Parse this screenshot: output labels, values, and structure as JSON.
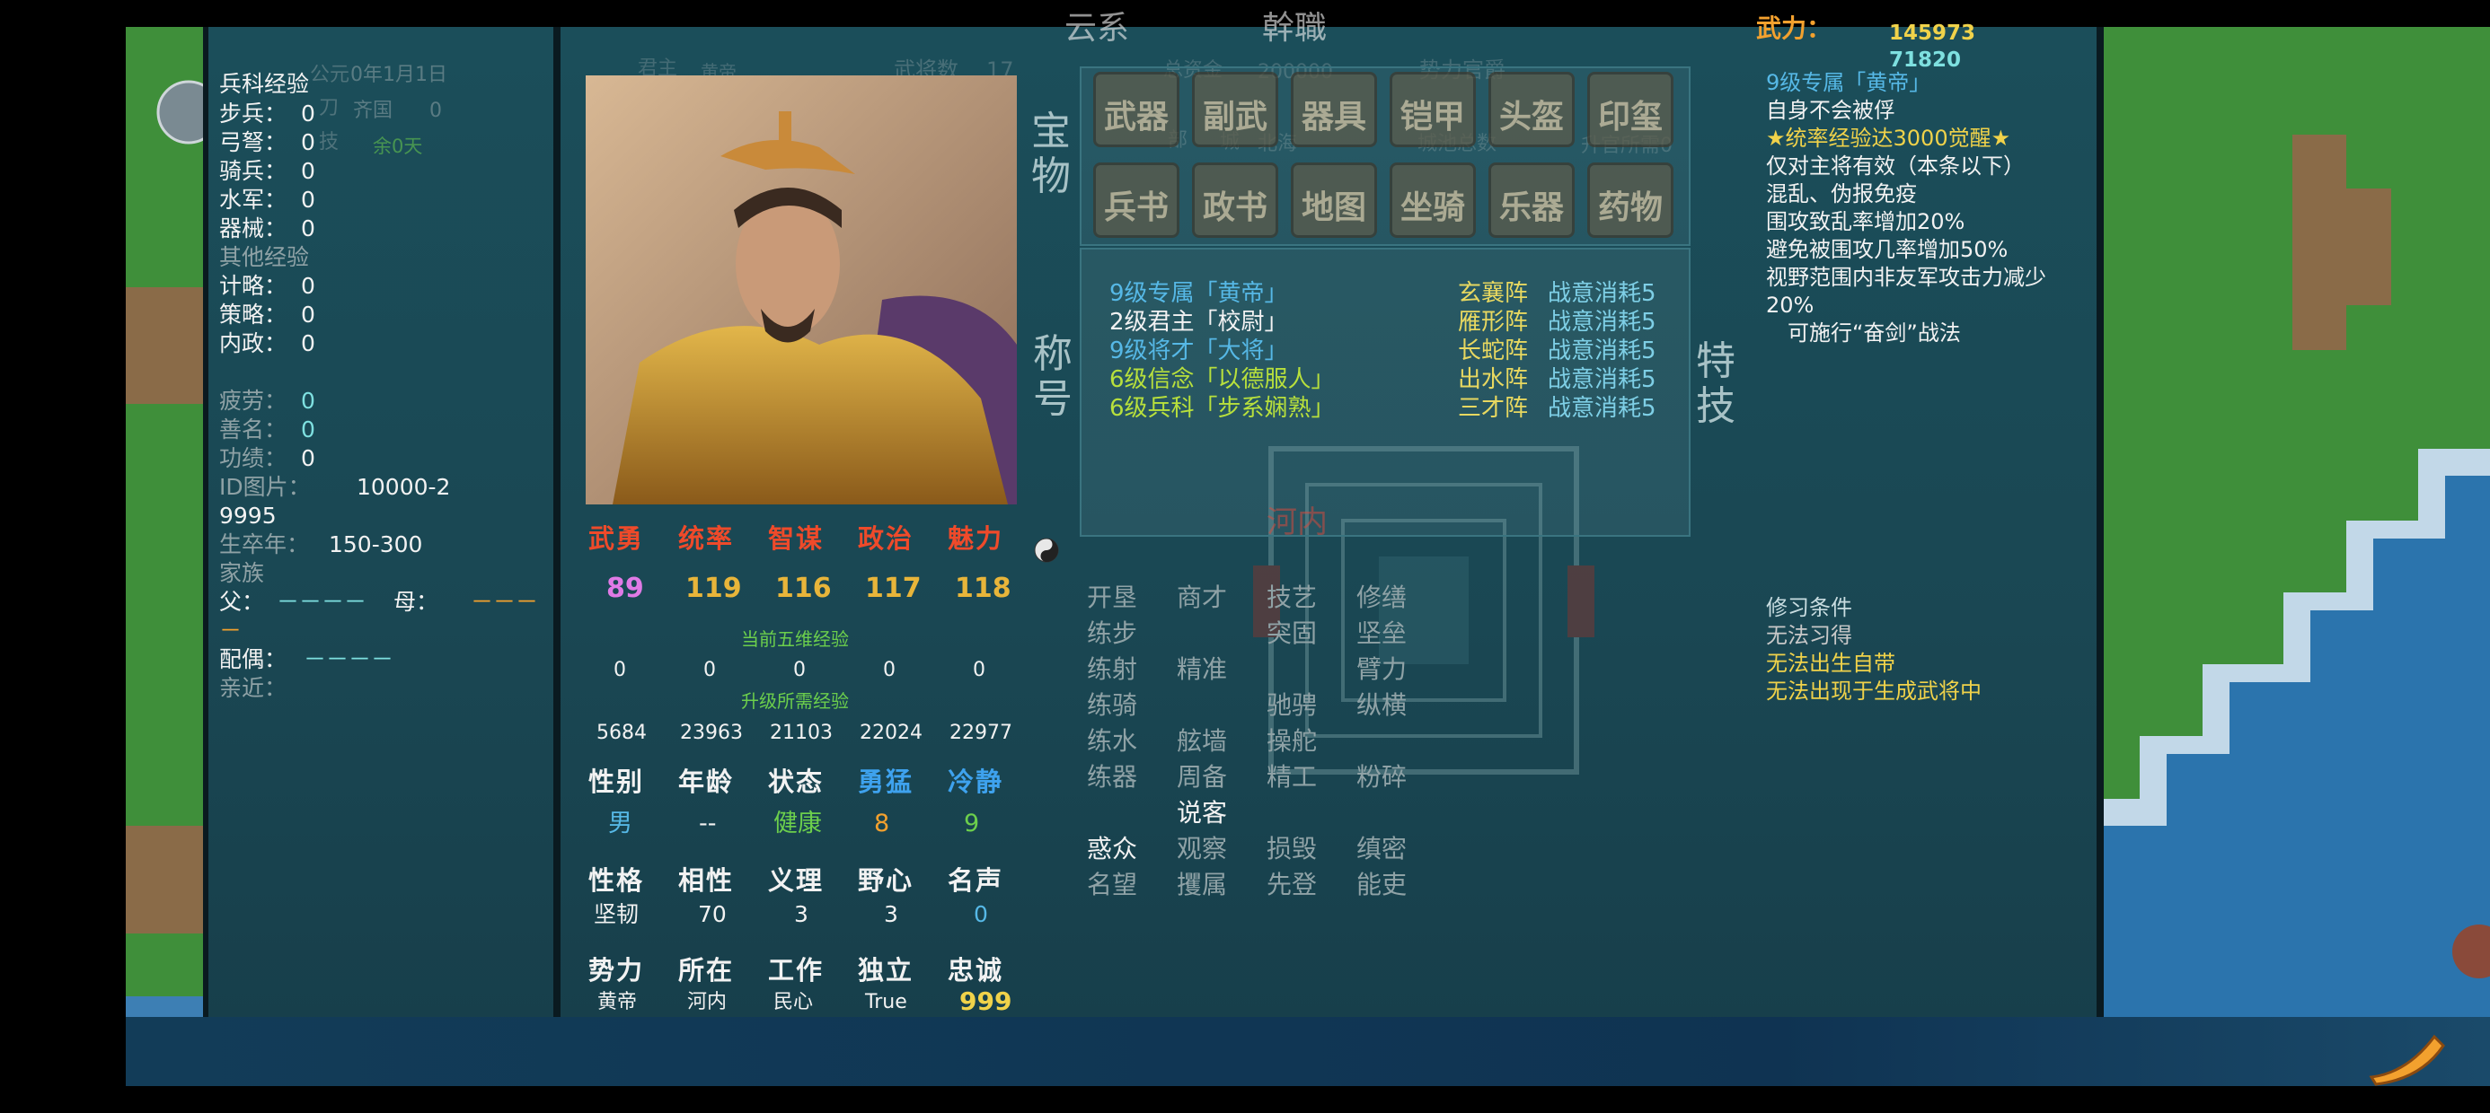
{
  "left_panel": {
    "bg_labels": [
      "公元",
      "0年1月1日",
      "刀",
      "齐国",
      "0",
      "技",
      "余0天"
    ],
    "troop_exp_title": "兵科经验",
    "troop_exp": [
      {
        "label": "步兵：",
        "value": "0"
      },
      {
        "label": "弓弩：",
        "value": "0"
      },
      {
        "label": "骑兵：",
        "value": "0"
      },
      {
        "label": "水军：",
        "value": "0"
      },
      {
        "label": "器械：",
        "value": "0"
      }
    ],
    "other_exp_title": "其他经验",
    "other_exp": [
      {
        "label": "计略：",
        "value": "0"
      },
      {
        "label": "策略：",
        "value": "0"
      },
      {
        "label": "内政：",
        "value": "0"
      }
    ],
    "fatigue_label": "疲劳：",
    "fatigue": "0",
    "goodname_label": "善名：",
    "goodname": "0",
    "merit_label": "功绩：",
    "merit": "0",
    "id_label": "ID图片：",
    "id_value": "10000-2",
    "id_value2": "9995",
    "life_label": "生卒年：",
    "life_value": "150-300",
    "family_label": "家族",
    "father_label": "父：",
    "father_value": "－－－－",
    "mother_label": "母：",
    "mother_value": "－－－",
    "mother_value2": "－",
    "spouse_label": "配偶：",
    "spouse_value": "－－－－",
    "intimate_label": "亲近："
  },
  "middle_bg": {
    "top_fragments": [
      "云系",
      "幹職",
      "武力：",
      "145973",
      "71820"
    ],
    "row2": [
      "君主",
      "黄帝",
      "武将数",
      "17",
      "总资金",
      "200000",
      "势力官爵"
    ],
    "row3": [
      "部",
      "城",
      "北海",
      "城池总数",
      "升官所需0"
    ]
  },
  "portrait": {
    "alt": "黄帝 portrait"
  },
  "stats": {
    "headers": [
      "武勇",
      "统率",
      "智谋",
      "政治",
      "魅力"
    ],
    "values": [
      "89",
      "119",
      "116",
      "117",
      "118"
    ],
    "cur_exp_label": "当前五维经验",
    "cur_exp": [
      "0",
      "0",
      "0",
      "0",
      "0"
    ],
    "need_exp_label": "升级所需经验",
    "need_exp": [
      "5684",
      "23963",
      "21103",
      "22024",
      "22977"
    ],
    "row_a_headers": [
      "性别",
      "年龄",
      "状态",
      "勇猛",
      "冷静"
    ],
    "row_a_values": [
      "男",
      "--",
      "健康",
      "8",
      "9"
    ],
    "row_b_headers": [
      "性格",
      "相性",
      "义理",
      "野心",
      "名声"
    ],
    "row_b_values": [
      "坚韧",
      "70",
      "3",
      "3",
      "0"
    ],
    "row_c_headers": [
      "势力",
      "所在",
      "工作",
      "独立",
      "忠诚"
    ],
    "row_c_values": [
      "黄帝",
      "河内",
      "民心",
      "True",
      "999"
    ]
  },
  "treasure": {
    "label": "宝物",
    "row1": [
      "武器",
      "副武",
      "器具",
      "铠甲",
      "头盔",
      "印玺"
    ],
    "row2": [
      "兵书",
      "政书",
      "地图",
      "坐骑",
      "乐器",
      "药物"
    ]
  },
  "titles": {
    "label": "称号",
    "items": [
      {
        "text": "9级专属「黄帝」",
        "color": "#56b8e6"
      },
      {
        "text": "2级君主「校尉」",
        "color": "#f2f2f2"
      },
      {
        "text": "9级将才「大将」",
        "color": "#56b8e6"
      },
      {
        "text": "6级信念「以德服人」",
        "color": "#b8e03c"
      },
      {
        "text": "6级兵科「步系娴熟」",
        "color": "#b8e03c"
      }
    ],
    "formations": [
      {
        "name": "玄襄阵",
        "cost": "战意消耗5"
      },
      {
        "name": "雁形阵",
        "cost": "战意消耗5"
      },
      {
        "name": "长蛇阵",
        "cost": "战意消耗5"
      },
      {
        "name": "出水阵",
        "cost": "战意消耗5"
      },
      {
        "name": "三才阵",
        "cost": "战意消耗5"
      }
    ]
  },
  "special_label": "特技",
  "skills": {
    "col1": [
      "开垦",
      "练步",
      "练射",
      "练骑",
      "练水",
      "练器",
      "",
      "惑众",
      "名望"
    ],
    "col2": [
      "商才",
      "",
      "精准",
      "",
      "舷墙",
      "周备",
      "说客",
      "观察",
      "攫属"
    ],
    "col3": [
      "技艺",
      "突固",
      "",
      "驰骋",
      "操舵",
      "精工",
      "",
      "损毁",
      "先登"
    ],
    "col4": [
      "修缮",
      "坚垒",
      "臂力",
      "纵横",
      "",
      "粉碎",
      "",
      "缜密",
      "能吏"
    ]
  },
  "map_labels": {
    "city": "河内"
  },
  "right_info": {
    "lines": [
      {
        "text": "9级专属「黄帝」",
        "color": "#56b8e6"
      },
      {
        "text": "自身不会被俘",
        "color": "#f2f2f2"
      },
      {
        "text": "★统率经验达3000觉醒★",
        "color": "#f0d24a"
      },
      {
        "text": "仅对主将有效（本条以下）",
        "color": "#f2f2f2"
      },
      {
        "text": "混乱、伪报免疫",
        "color": "#f2f2f2"
      },
      {
        "text": "围攻致乱率增加20%",
        "color": "#f2f2f2"
      },
      {
        "text": "避免被围攻几率增加50%",
        "color": "#f2f2f2"
      },
      {
        "text": "视野范围内非友军攻击力减少",
        "color": "#f2f2f2"
      },
      {
        "text": "20%",
        "color": "#f2f2f2"
      },
      {
        "text": "　可施行“奋剑”战法",
        "color": "#f2f2f2"
      }
    ],
    "cond_title": "修习条件",
    "cond_lines": [
      {
        "text": "无法习得",
        "color": "#c8c8c8"
      },
      {
        "text": "无法出生自带",
        "color": "#f0d24a"
      },
      {
        "text": "无法出现于生成武将中",
        "color": "#f0d24a"
      }
    ]
  }
}
